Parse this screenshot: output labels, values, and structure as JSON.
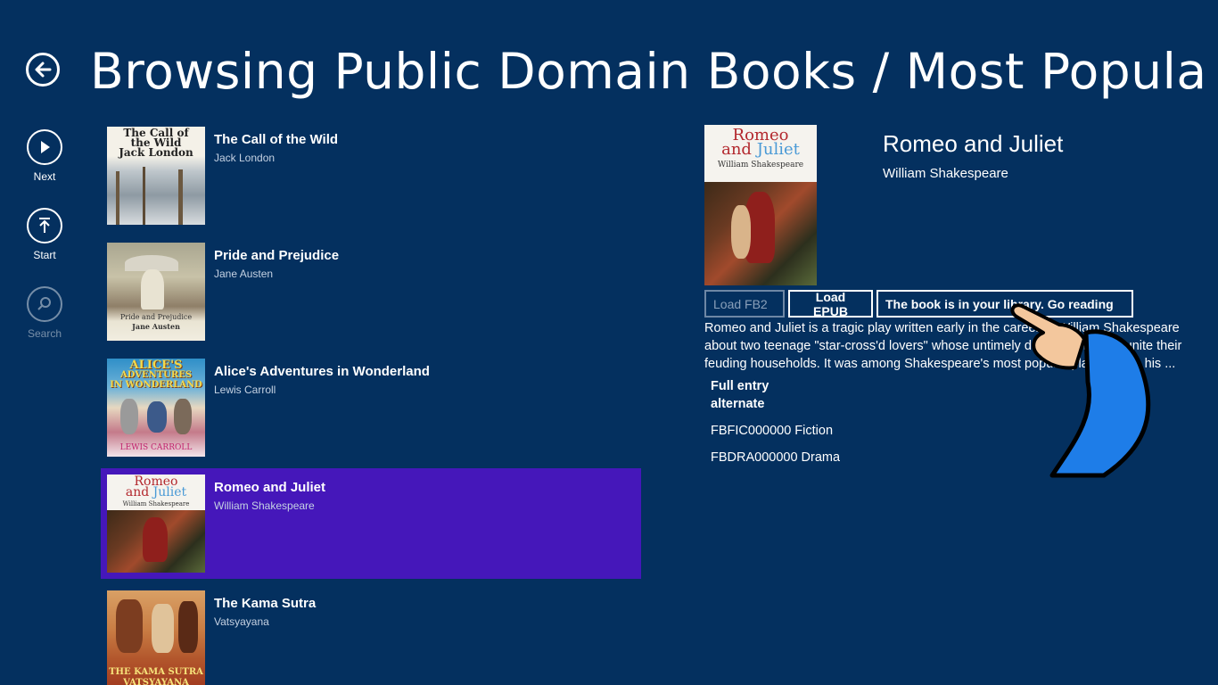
{
  "header": {
    "title": "Browsing Public Domain Books / Most Popular (T..."
  },
  "appbar": {
    "next_label": "Next",
    "start_label": "Start",
    "search_label": "Search"
  },
  "books": [
    {
      "title": "The Call of the Wild",
      "author": "Jack London",
      "cover_text_1": "The Call of",
      "cover_text_2": "the Wild",
      "cover_text_3": "Jack London"
    },
    {
      "title": "Pride and Prejudice",
      "author": "Jane Austen",
      "cover_text_1": "Pride and Prejudice",
      "cover_text_2": "Jane Austen"
    },
    {
      "title": "Alice's Adventures in Wonderland",
      "author": "Lewis Carroll",
      "cover_text_1": "ALICE'S",
      "cover_text_2": "ADVENTURES",
      "cover_text_3": "IN WONDERLAND",
      "cover_text_4": "LEWIS CARROLL"
    },
    {
      "title": "Romeo and Juliet",
      "author": "William Shakespeare",
      "cover_text_1": "Romeo",
      "cover_text_2": "and",
      "cover_text_3": "Juliet",
      "cover_text_4": "William Shakespeare"
    },
    {
      "title": "The Kama Sutra",
      "author": "Vatsyayana",
      "cover_text_1": "THE KAMA SUTRA",
      "cover_text_2": "VATSYAYANA"
    }
  ],
  "selected_index": 3,
  "detail": {
    "title": "Romeo and Juliet",
    "author": "William Shakespeare",
    "cover_text_1": "Romeo",
    "cover_text_2": "and",
    "cover_text_3": "Juliet",
    "cover_text_4": "William Shakespeare",
    "load_fb2_label": "Load FB2",
    "load_epub_label": "Load EPUB",
    "go_reading_label": "The book is in your library. Go reading",
    "description": "Romeo and Juliet is a tragic play written early in the career of William Shakespeare about two teenage \"star-cross'd lovers\" whose untimely deaths ultimately unite their feuding households. It was among Shakespeare's most popular plays during his ...",
    "full_entry_label": "Full entry",
    "alternate_label": "alternate",
    "categories": [
      "FBFIC000000 Fiction",
      "FBDRA000000 Drama"
    ]
  },
  "colors": {
    "background": "#04305f",
    "selected": "#4517ba",
    "hand_sleeve": "#1e7de8",
    "hand_skin": "#f3c79d"
  }
}
